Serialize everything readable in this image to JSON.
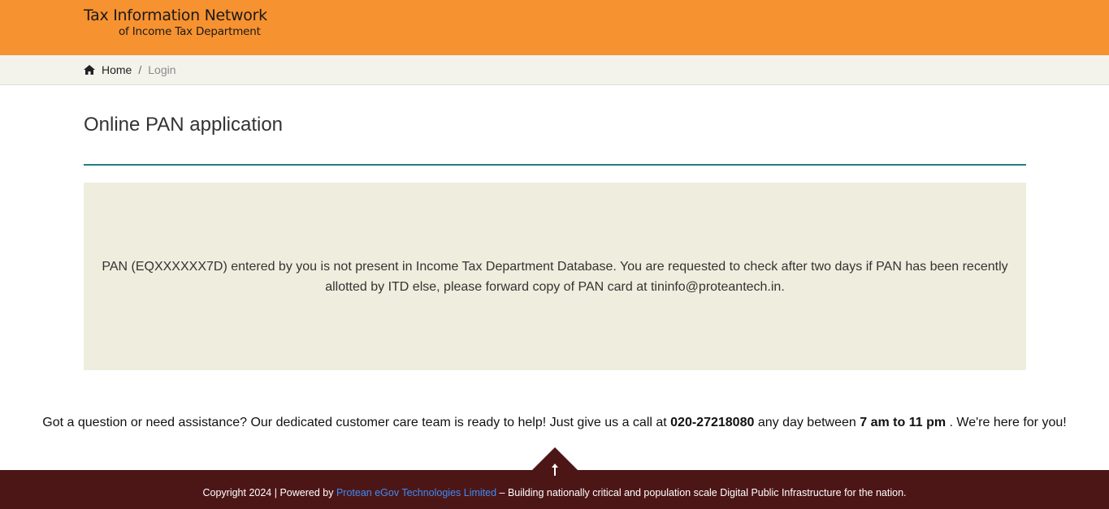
{
  "header": {
    "logo_line1": "Tax Information Network",
    "logo_line2": "of Income Tax Department",
    "background_color": "#f79230"
  },
  "breadcrumb": {
    "home_icon": "home-icon",
    "home_label": "Home",
    "separator": "/",
    "current": "Login"
  },
  "main": {
    "title": "Online PAN application",
    "message": "PAN (EQXXXXXX7D) entered by you is not present in Income Tax Department Database. You are requested to check after two days if PAN has been recently allotted by ITD else, please forward copy of PAN card at tininfo@proteantech.in.",
    "accent_color": "#1f7f86"
  },
  "assistance": {
    "text_before": "Got a question or need assistance? Our dedicated customer care team is ready to help! Just give us a call at ",
    "phone": "020-27218080",
    "text_middle": " any day between ",
    "hours": "7 am to 11 pm",
    "text_after": " . We're here for you!"
  },
  "footer": {
    "scroll_top_icon": "arrow-up-icon",
    "copyright": "Copyright 2024 | Powered by ",
    "company_link": "Protean eGov Technologies Limited",
    "tagline": " – Building nationally critical and population scale Digital Public Infrastructure for the nation.",
    "background_color": "#4d1616"
  }
}
